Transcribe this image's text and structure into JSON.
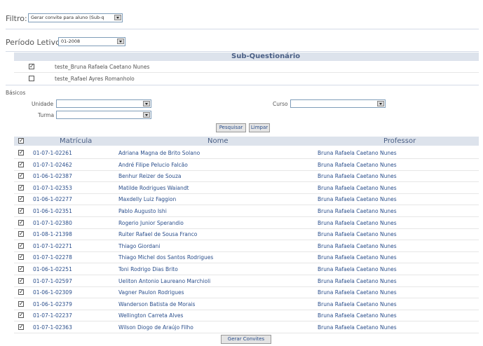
{
  "filter": {
    "label": "Filtro:",
    "value": "Gerar convite para aluno (Sub-q"
  },
  "period": {
    "label": "Período Letivo:",
    "value": "01-2008"
  },
  "subquestionnaire": {
    "title": "Sub-Questionário",
    "items": [
      {
        "label": "teste_Bruna Rafaela Caetano Nunes",
        "checked": true
      },
      {
        "label": "teste_Rafael Ayres Romanholo",
        "checked": false
      }
    ]
  },
  "basics": {
    "title": "Básicos",
    "unidade_label": "Unidade",
    "curso_label": "Curso",
    "turma_label": "Turma",
    "search_button": "Pesquisar",
    "clear_button": "Limpar"
  },
  "table": {
    "headers": {
      "matricula": "Matrícula",
      "nome": "Nome",
      "professor": "Professor"
    },
    "rows": [
      {
        "matricula": "01-07-1-02261",
        "nome": "Adriana Magna de Brito Solano",
        "professor": "Bruna Rafaela Caetano Nunes"
      },
      {
        "matricula": "01-07-1-02462",
        "nome": "André Filipe Pelucio Falcão",
        "professor": "Bruna Rafaela Caetano Nunes"
      },
      {
        "matricula": "01-06-1-02387",
        "nome": "Benhur Reizer de Souza",
        "professor": "Bruna Rafaela Caetano Nunes"
      },
      {
        "matricula": "01-07-1-02353",
        "nome": "Matilde Rodrigues Waiandt",
        "professor": "Bruna Rafaela Caetano Nunes"
      },
      {
        "matricula": "01-06-1-02277",
        "nome": "Maxdelly Luiz Faggion",
        "professor": "Bruna Rafaela Caetano Nunes"
      },
      {
        "matricula": "01-06-1-02351",
        "nome": "Pablo Augusto Ishi",
        "professor": "Bruna Rafaela Caetano Nunes"
      },
      {
        "matricula": "01-07-1-02380",
        "nome": "Rogerio Junior Sperandio",
        "professor": "Bruna Rafaela Caetano Nunes"
      },
      {
        "matricula": "01-08-1-21398",
        "nome": "Ruiter Rafael de Sousa Franco",
        "professor": "Bruna Rafaela Caetano Nunes"
      },
      {
        "matricula": "01-07-1-02271",
        "nome": "Thiago Giordani",
        "professor": "Bruna Rafaela Caetano Nunes"
      },
      {
        "matricula": "01-07-1-02278",
        "nome": "Thiago Michel dos Santos Rodrigues",
        "professor": "Bruna Rafaela Caetano Nunes"
      },
      {
        "matricula": "01-06-1-02251",
        "nome": "Toni Rodrigo Dias Brito",
        "professor": "Bruna Rafaela Caetano Nunes"
      },
      {
        "matricula": "01-07-1-02597",
        "nome": "Ueliton Antonio Laureano Marchioli",
        "professor": "Bruna Rafaela Caetano Nunes"
      },
      {
        "matricula": "01-06-1-02309",
        "nome": "Vagner Paulon Rodrigues",
        "professor": "Bruna Rafaela Caetano Nunes"
      },
      {
        "matricula": "01-06-1-02379",
        "nome": "Wanderson Batista de Morais",
        "professor": "Bruna Rafaela Caetano Nunes"
      },
      {
        "matricula": "01-07-1-02237",
        "nome": "Wellington Carreta Alves",
        "professor": "Bruna Rafaela Caetano Nunes"
      },
      {
        "matricula": "01-07-1-02363",
        "nome": "Wilson Diogo de Araújo Filho",
        "professor": "Bruna Rafaela Caetano Nunes"
      }
    ]
  },
  "footer": {
    "generate_button": "Gerar Convites"
  }
}
